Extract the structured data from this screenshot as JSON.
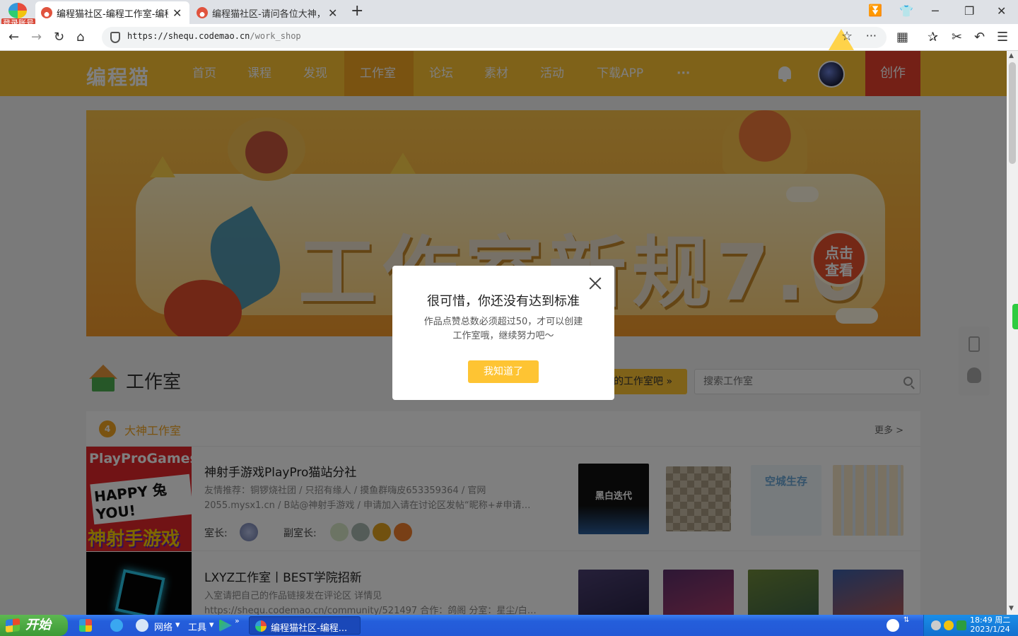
{
  "browser": {
    "login_badge": "登录账号",
    "tabs": [
      {
        "title": "编程猫社区-编程工作室-编程"
      },
      {
        "title": "编程猫社区-请问各位大神，怎"
      }
    ],
    "new_tab": "+",
    "url_host": "https://shequ.codemao.cn",
    "url_path": "/work_shop",
    "window_controls": [
      "minimize-icon",
      "maximize-icon",
      "close-icon"
    ]
  },
  "site": {
    "logo": "编程猫",
    "nav": [
      "首页",
      "课程",
      "发现",
      "工作室",
      "论坛",
      "素材",
      "活动",
      "下载APP",
      "···"
    ],
    "active_nav": "工作室",
    "create_label": "创作",
    "brand_color": "#fec433",
    "accent_red": "#e8412c"
  },
  "banner": {
    "title": "工作室新规7.0",
    "badge_line1": "点击",
    "badge_line2": "查看"
  },
  "workshop": {
    "title": "工作室",
    "create_label": "的工作室吧 »",
    "search_placeholder": "搜索工作室",
    "section_title": "大神工作室",
    "section_rank": "4",
    "more_label": "更多 >",
    "items": [
      {
        "title": "神射手游戏PlayPro猫站分社",
        "desc1": "友情推荐：铜锣烧社团 / 只招有缘人 / 摸鱼群嗨皮653359364 / 官网",
        "desc2": "2055.mysx1.cn / B站@神射手游戏 / 申请加入请在讨论区发帖“昵称+#申请…",
        "owner_label": "室长:",
        "deputy_label": "副室长:",
        "cover_top": "PlayProGames",
        "cover_mid": "HAPPY 兔 YOU!",
        "cover_bottom": "神射手游戏",
        "thumb_text": [
          "黑白迭代",
          "",
          "空城生存",
          ""
        ]
      },
      {
        "title": "LXYZ工作室丨BEST学院招新",
        "desc1": "入室请把自己的作品链接发在评论区 详情见",
        "desc2": "https://shequ.codemao.cn/community/521497 合作：鸽阁 分室：星尘/白…"
      }
    ]
  },
  "dialog": {
    "title": "很可惜，你还没有达到标准",
    "message": "作品点赞总数必须超过50，才可以创建工作室哦，继续努力吧～",
    "button": "我知道了"
  },
  "taskbar": {
    "start": "开始",
    "network": "网络",
    "tools": "工具",
    "expand": "»",
    "task_title": "编程猫社区-编程...",
    "clock_time": "18:49 周二",
    "clock_date": "2023/1/24"
  }
}
